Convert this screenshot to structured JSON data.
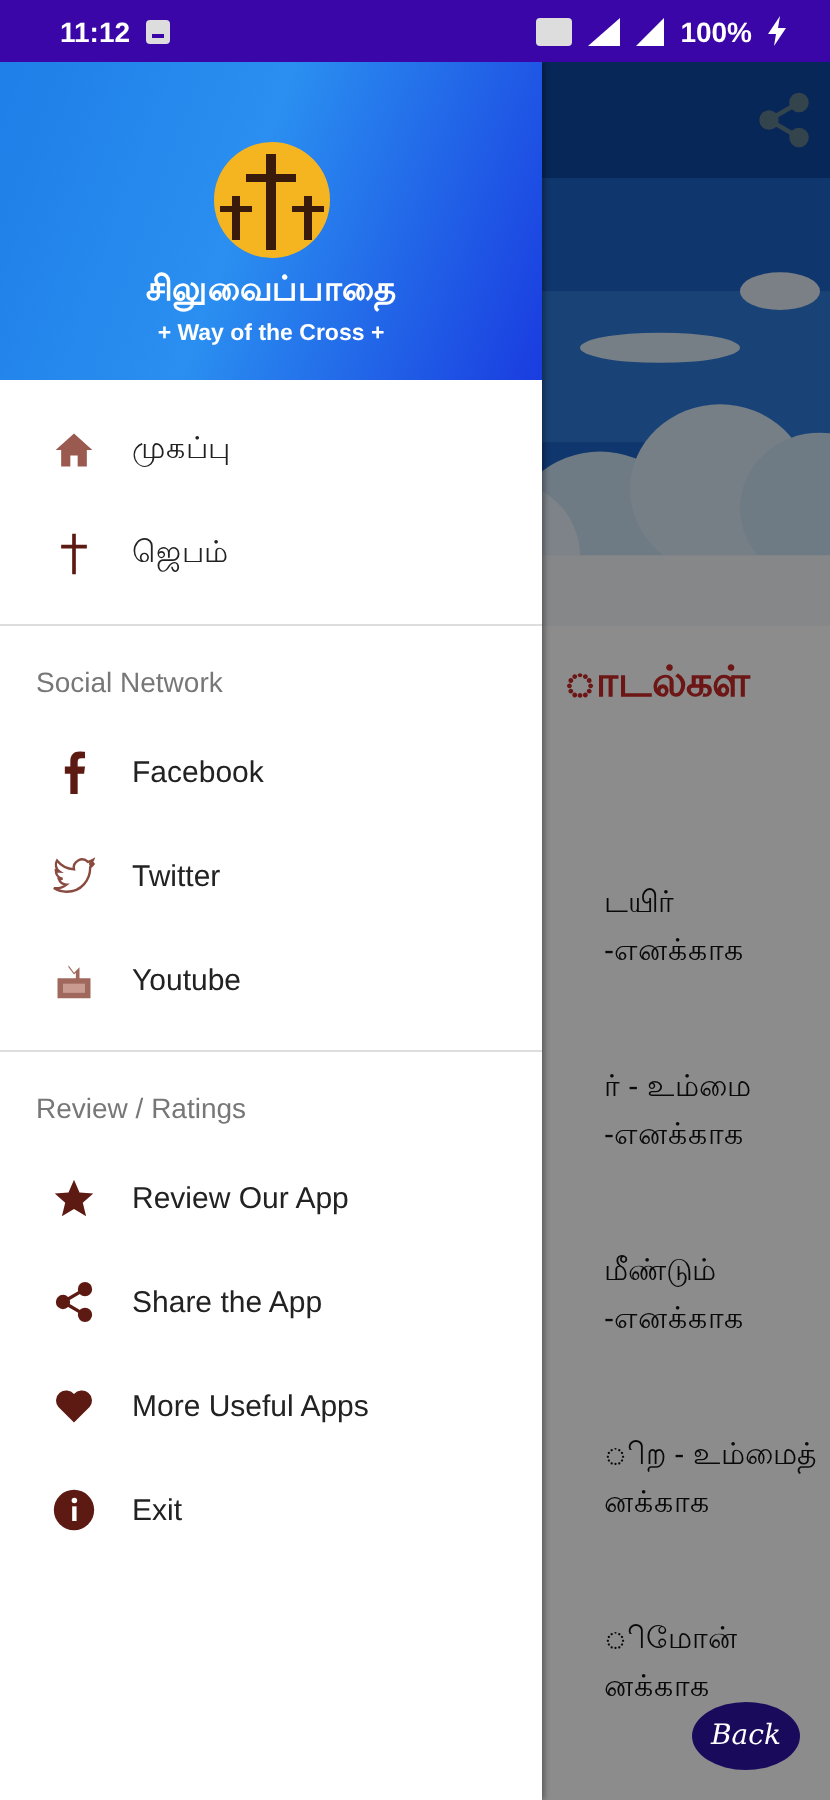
{
  "status_bar": {
    "time": "11:12",
    "battery": "100%"
  },
  "background": {
    "heading": "ாடல்கள்",
    "entries": [
      {
        "line_1": "டயிர்",
        "line_2": "-எனக்காக"
      },
      {
        "line_1": "ர் - உம்மை",
        "line_2": "-எனக்காக"
      },
      {
        "line_1": "மீண்டும்",
        "line_2": "-எனக்காக"
      },
      {
        "line_1": "ிற - உம்மைத்",
        "line_2": "னக்காக"
      },
      {
        "line_1": "ிமோன்",
        "line_2": "னக்காக"
      }
    ],
    "back_button": "Back"
  },
  "drawer": {
    "title": "சிலுவைப்பாதை",
    "subtitle": "+ Way of the Cross +",
    "sections": [
      {
        "items": [
          {
            "label": "முகப்பு"
          },
          {
            "label": "ஜெபம்"
          }
        ]
      },
      {
        "header": "Social Network",
        "items": [
          {
            "label": "Facebook"
          },
          {
            "label": "Twitter"
          },
          {
            "label": "Youtube"
          }
        ]
      },
      {
        "header": "Review / Ratings",
        "items": [
          {
            "label": "Review Our App"
          },
          {
            "label": "Share the App"
          },
          {
            "label": "More Useful Apps"
          },
          {
            "label": "Exit"
          }
        ]
      }
    ]
  }
}
